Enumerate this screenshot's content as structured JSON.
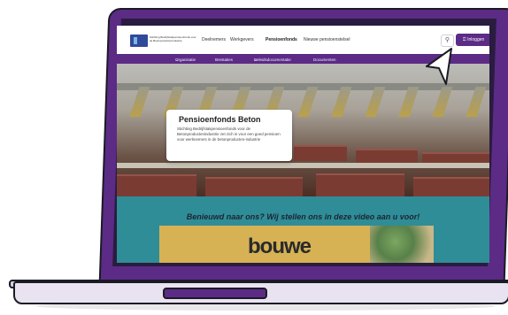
{
  "header": {
    "brand_text": "Stichting Bedrijfstakpensioenfonds voor de Betonproductenindustrie",
    "nav": [
      "Deelnemers",
      "Werkgevers",
      "Pensioenfonds",
      "Nieuwe pensioenstelsel"
    ],
    "active_nav": "Pensioenfonds",
    "search_icon": "search-icon",
    "login_label": "Inloggen",
    "login_icon": "lock-icon"
  },
  "submenu": {
    "items": [
      "Organisatie",
      "Prestaties",
      "Beleidsdocumentatie",
      "Documenten"
    ]
  },
  "hero": {
    "title": "Pensioenfonds Beton",
    "text": "Stichting Bedrijfstakpensioenfonds voor de Betonproductenindustrie zet zich in voor een goed pensioen voor werknemers in de betonproducten-industrie"
  },
  "video_section": {
    "heading": "Benieuwd naar ons? Wij stellen ons in deze video aan u voor!",
    "thumbnail_text": "bouwe"
  },
  "colors": {
    "brand_purple": "#5b2b86",
    "teal": "#2f8d97"
  }
}
